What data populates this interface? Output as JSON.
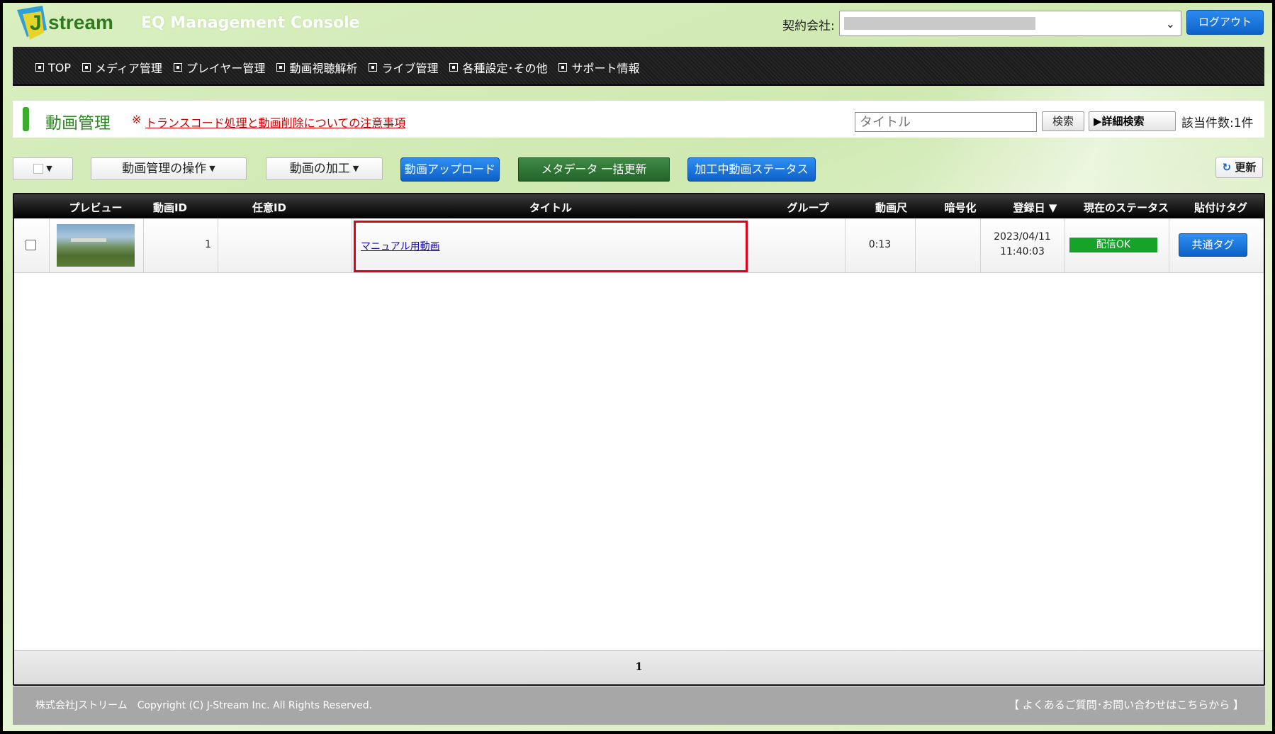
{
  "header": {
    "console_title": "EQ Management Console",
    "contract_label": "契約会社:",
    "logout_label": "ログアウト"
  },
  "nav": {
    "items": [
      {
        "label": "TOP"
      },
      {
        "label": "メディア管理"
      },
      {
        "label": "プレイヤー管理"
      },
      {
        "label": "動画視聴解析"
      },
      {
        "label": "ライブ管理"
      },
      {
        "label": "各種設定･その他"
      },
      {
        "label": "サポート情報"
      }
    ]
  },
  "page": {
    "title": "動画管理",
    "notice_mark": "※",
    "notice_link": "トランスコード処理と動画削除についての注意事項",
    "search_placeholder": "タイトル",
    "search_label": "検索",
    "advanced_search_label": "▶詳細検索",
    "result_count": "該当件数:1件"
  },
  "toolbar": {
    "manage_ops_label": "動画管理の操作",
    "processing_label": "動画の加工",
    "upload_label": "動画アップロード",
    "metadata_bulk_label": "メタデータ 一括更新",
    "processing_status_label": "加工中動画ステータス",
    "refresh_label": "更新"
  },
  "table": {
    "headers": {
      "preview": "プレビュー",
      "video_id": "動画ID",
      "custom_id": "任意ID",
      "title": "タイトル",
      "group": "グループ",
      "duration": "動画尺",
      "encryption": "暗号化",
      "registered": "登録日 ▼",
      "status": "現在のステータス",
      "embed_tag": "貼付けタグ"
    },
    "rows": [
      {
        "video_id": "1",
        "custom_id": "",
        "title": "マニュアル用動画",
        "group": "",
        "duration": "0:13",
        "encryption": "",
        "registered_date": "2023/04/11",
        "registered_time": "11:40:03",
        "status": "配信OK",
        "tag_button": "共通タグ"
      }
    ],
    "pagination": "1"
  },
  "footer": {
    "copyright": "株式会社Jストリーム　Copyright (C) J-Stream Inc. All Rights Reserved.",
    "faq_link": "【 よくあるご質問･お問い合わせはこちらから 】"
  },
  "colors": {
    "accent_green": "#3cad2d",
    "primary_blue": "#0d62c9",
    "status_ok": "#16a32a",
    "highlight_red": "#e0001b"
  }
}
